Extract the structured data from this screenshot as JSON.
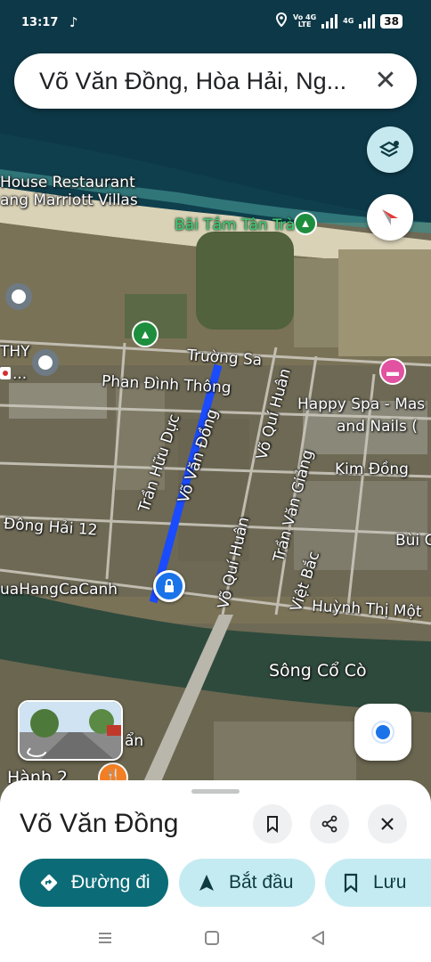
{
  "status_bar": {
    "time": "13:17",
    "volte_label": "Vo 4G",
    "lte_label": "LTE",
    "net_label": "4G",
    "battery": "38"
  },
  "search": {
    "query": "Võ Văn Đồng, Hòa Hải, Ng...",
    "clear_icon": "close-icon"
  },
  "map": {
    "labels": {
      "house_restaurant": "House Restaurant",
      "marriott": "ang Marriott Villas",
      "bai_tam": "Bãi Tắm Tân Trà",
      "truong_sa": "Trường Sa",
      "phan_dinh_thong": "Phan Đình Thông",
      "happy_spa": "Happy Spa - Mas",
      "and_nails": "and Nails (",
      "thy": "THY",
      "dots": "...",
      "tran_huu_duc": "Trần Hữu Dực",
      "vo_van_dong": "Võ Văn Đồng",
      "vo_qui_huan_1": "Võ Quí Huân",
      "vo_qui_huan_2": "Võ Quí Huân",
      "tran_van_giang": "Trần Văn Giảng",
      "kim_dong": "Kim Đồng",
      "dong_hai_12": "Đông Hải 12",
      "bui": "Bùi C",
      "viet_bac": "Việt Bắc",
      "huynh_thi_mot": "Huỳnh Thị Một",
      "quahang": "uaHangCaCanh",
      "song_co_co": "Sông Cổ Cò",
      "an": "ẩn",
      "hanh_2": "Hành 2"
    },
    "route_color": "#1a4bff"
  },
  "place": {
    "name": "Võ Văn Đồng",
    "actions": {
      "directions": "Đường đi",
      "start": "Bắt đầu",
      "save": "Lưu"
    }
  },
  "colors": {
    "primary": "#0b6b77",
    "tonal": "#c5ebf2",
    "accent_blue": "#1a73e8"
  }
}
